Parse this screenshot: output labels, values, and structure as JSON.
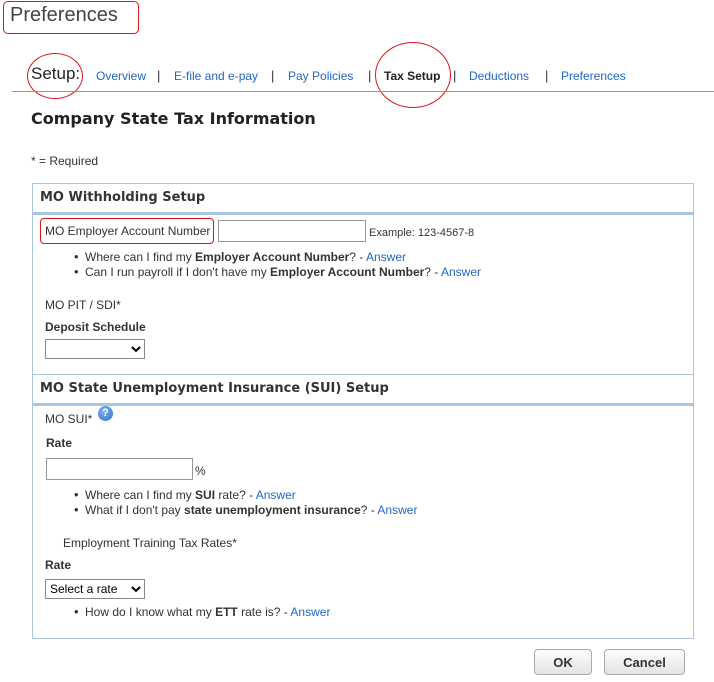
{
  "header": {
    "title": "Preferences"
  },
  "nav": {
    "setup_label": "Setup:",
    "items": [
      {
        "label": "Overview"
      },
      {
        "label": "E-file and e-pay"
      },
      {
        "label": "Pay Policies"
      },
      {
        "label": "Tax Setup"
      },
      {
        "label": "Deductions"
      },
      {
        "label": "Preferences"
      }
    ],
    "active": "Tax Setup"
  },
  "page": {
    "title": "Company State Tax Information",
    "required_note": "* = Required"
  },
  "withholding": {
    "heading": "MO Withholding Setup",
    "account_label": "MO Employer Account Number",
    "account_value": "",
    "account_example": "Example: 123-4567-8",
    "faq1": {
      "pre": "Where can I find my ",
      "bold": "Employer Account Number",
      "post": "? - ",
      "link": "Answer"
    },
    "faq2": {
      "pre": "Can I run payroll if I don't have my ",
      "bold": "Employer Account Number",
      "post": "? - ",
      "link": "Answer"
    },
    "pit_label": "MO PIT / SDI*",
    "deposit_label": "Deposit Schedule",
    "deposit_value": ""
  },
  "sui": {
    "heading": "MO State Unemployment Insurance (SUI) Setup",
    "label": "MO SUI*",
    "rate_label": "Rate",
    "rate_value": "",
    "percent": "%",
    "faq1": {
      "pre": "Where can I find my ",
      "bold": "SUI",
      "post": " rate? - ",
      "link": "Answer"
    },
    "faq2": {
      "pre": "What if I don't pay ",
      "bold": "state unemployment insurance",
      "post": "? - ",
      "link": "Answer"
    },
    "ett_label": "Employment Training Tax Rates*",
    "ett_rate_label": "Rate",
    "ett_select": "Select a rate",
    "faq3": {
      "pre": "How do I know what my ",
      "bold": "ETT",
      "post": " rate is? - ",
      "link": "Answer"
    }
  },
  "buttons": {
    "ok": "OK",
    "cancel": "Cancel"
  },
  "colors": {
    "accent": "#1f67c1",
    "border": "#a9c6e0",
    "annotation": "#d9161d"
  }
}
